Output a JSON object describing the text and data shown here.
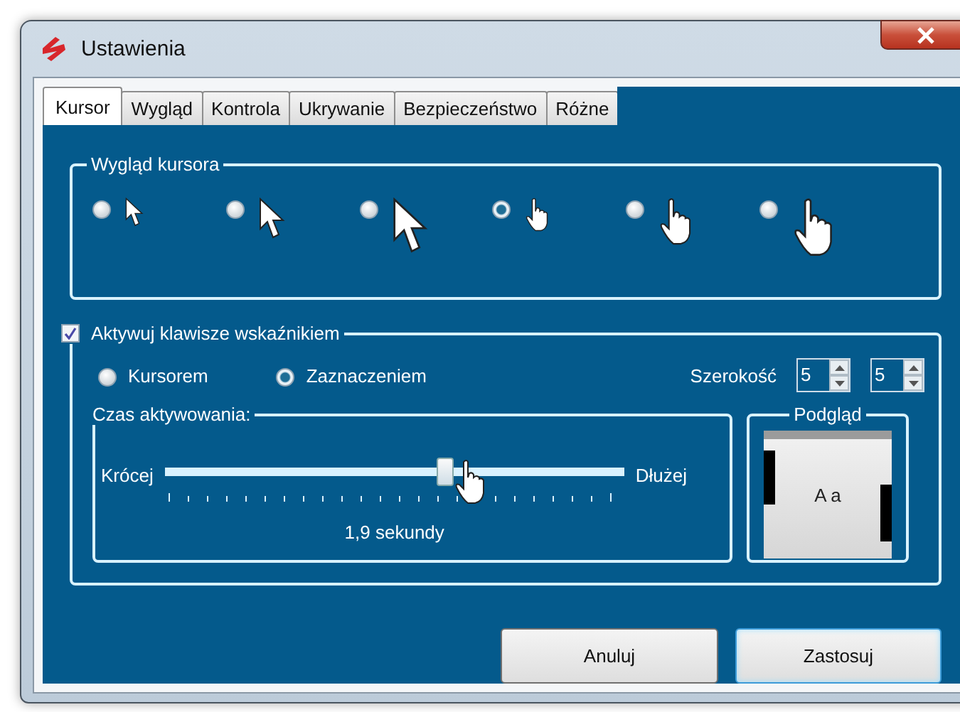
{
  "window": {
    "title": "Ustawienia"
  },
  "tabs": [
    {
      "label": "Kursor",
      "selected": true
    },
    {
      "label": "Wygląd",
      "selected": false
    },
    {
      "label": "Kontrola",
      "selected": false
    },
    {
      "label": "Ukrywanie",
      "selected": false
    },
    {
      "label": "Bezpieczeństwo",
      "selected": false
    },
    {
      "label": "Różne",
      "selected": false
    }
  ],
  "cursor_group": {
    "title": "Wygląd kursora",
    "options": [
      {
        "kind": "arrow-small",
        "selected": false
      },
      {
        "kind": "arrow-medium",
        "selected": false
      },
      {
        "kind": "arrow-large",
        "selected": false
      },
      {
        "kind": "hand-small",
        "selected": true
      },
      {
        "kind": "hand-medium",
        "selected": false
      },
      {
        "kind": "hand-large",
        "selected": false
      }
    ]
  },
  "pointer_keys": {
    "label": "Aktywuj klawisze wskaźnikiem",
    "checked": true,
    "modes": [
      {
        "label": "Kursorem",
        "selected": false
      },
      {
        "label": "Zaznaczeniem",
        "selected": true
      }
    ],
    "width_label": "Szerokość",
    "width_values": [
      "5",
      "5"
    ],
    "time_group": {
      "title": "Czas aktywowania:",
      "min_label": "Krócej",
      "max_label": "Dłużej",
      "level": 0.61,
      "reading": "1,9 sekundy"
    },
    "preview_group": {
      "title": "Podgląd",
      "sample": "A a"
    }
  },
  "buttons": [
    {
      "label": "Anuluj",
      "default": false
    },
    {
      "label": "Zastosuj",
      "default": true
    }
  ]
}
